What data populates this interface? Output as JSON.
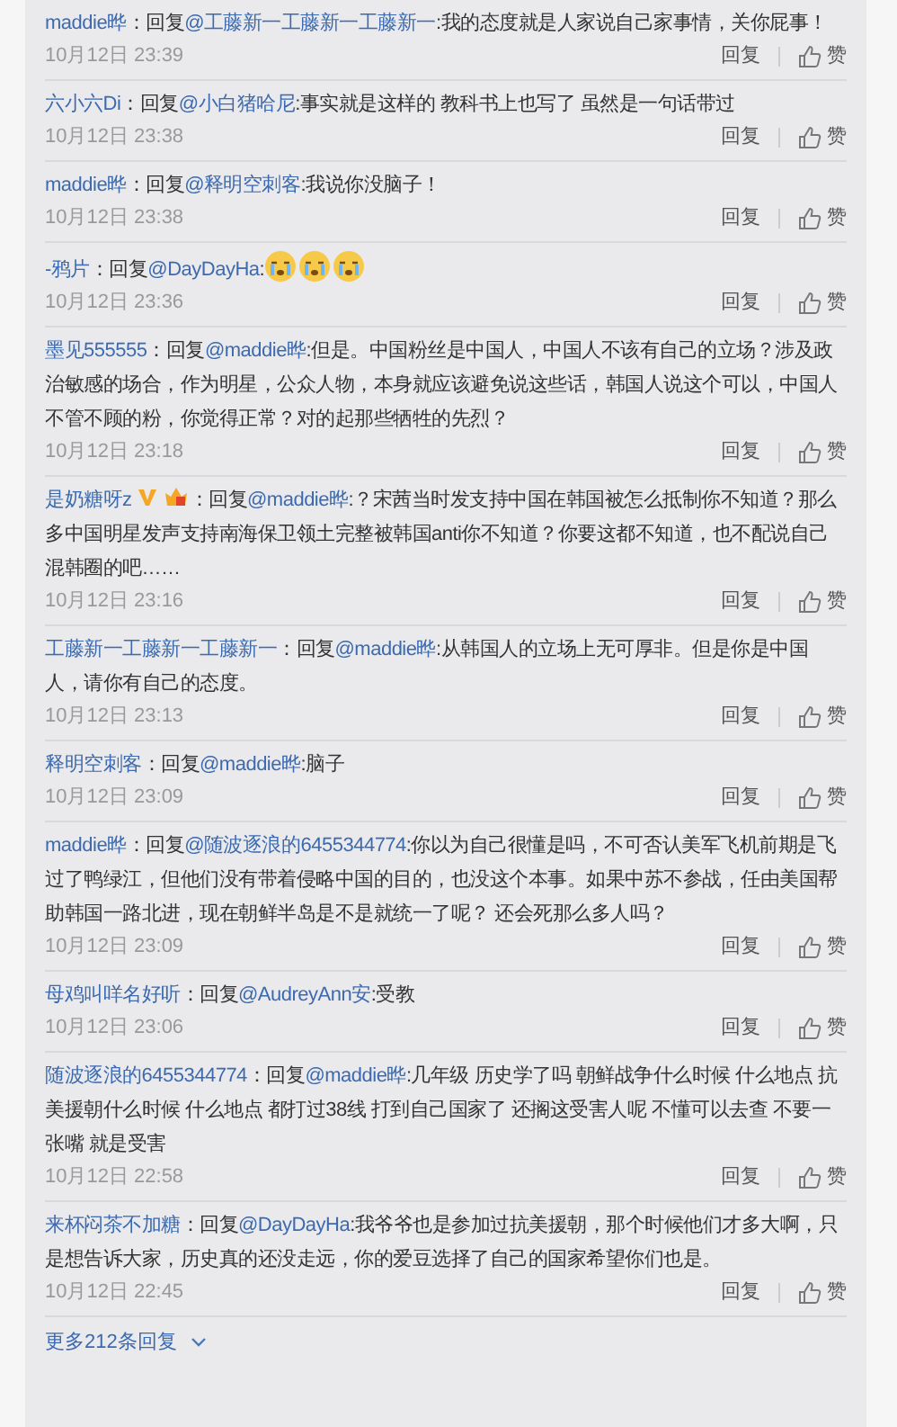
{
  "comments": [
    {
      "user": "maddie晔",
      "prefix": "：回复",
      "target": "@工藤新一工藤新一工藤新一",
      "body": ":我的态度就是人家说自己家事情，关你屁事！",
      "time": "10月12日 23:39",
      "reply": "回复",
      "like": "赞"
    },
    {
      "user": "六小六Di",
      "prefix": "：回复",
      "target": "@小白猪哈尼",
      "body": ":事实就是这样的 教科书上也写了 虽然是一句话带过",
      "time": "10月12日 23:38",
      "reply": "回复",
      "like": "赞"
    },
    {
      "user": "maddie晔",
      "prefix": "：回复",
      "target": "@释明空刺客",
      "body": ":我说你没脑子！",
      "time": "10月12日 23:38",
      "reply": "回复",
      "like": "赞"
    },
    {
      "user": "-鸦片",
      "prefix": "：回复",
      "target": "@DayDayHa",
      "body": ":",
      "emojis": [
        {
          "kind": "cry"
        },
        {
          "kind": "cry"
        },
        {
          "kind": "cry"
        }
      ],
      "time": "10月12日 23:36",
      "reply": "回复",
      "like": "赞"
    },
    {
      "user": "墨见555555",
      "prefix": "：回复",
      "target": "@maddie晔",
      "body": ":但是。中国粉丝是中国人，中国人不该有自己的立场？涉及政治敏感的场合，作为明星，公众人物，本身就应该避免说这些话，韩国人说这个可以，中国人不管不顾的粉，你觉得正常？对的起那些牺牲的先烈？",
      "time": "10月12日 23:18",
      "reply": "回复",
      "like": "赞"
    },
    {
      "user": "是奶糖呀z",
      "badges": [
        {
          "kind": "verified"
        },
        {
          "kind": "vip"
        }
      ],
      "prefix": "：回复",
      "target": "@maddie晔",
      "body": ":？宋茜当时发支持中国在韩国被怎么抵制你不知道？那么多中国明星发声支持南海保卫领土完整被韩国anti你不知道？你要这都不知道，也不配说自己混韩圈的吧……",
      "time": "10月12日 23:16",
      "reply": "回复",
      "like": "赞"
    },
    {
      "user": "工藤新一工藤新一工藤新一",
      "prefix": "：回复",
      "target": "@maddie晔",
      "body": ":从韩国人的立场上无可厚非。但是你是中国人，请你有自己的态度。",
      "time": "10月12日 23:13",
      "reply": "回复",
      "like": "赞"
    },
    {
      "user": "释明空刺客",
      "prefix": "：回复",
      "target": "@maddie晔",
      "body": ":脑子",
      "time": "10月12日 23:09",
      "reply": "回复",
      "like": "赞"
    },
    {
      "user": "maddie晔",
      "prefix": "：回复",
      "target": "@随波逐浪的6455344774",
      "body": ":你以为自己很懂是吗，不可否认美军飞机前期是飞过了鸭绿江，但他们没有带着侵略中国的目的，也没这个本事。如果中苏不参战，任由美国帮助韩国一路北进，现在朝鲜半岛是不是就统一了呢？ 还会死那么多人吗？",
      "time": "10月12日 23:09",
      "reply": "回复",
      "like": "赞"
    },
    {
      "user": "母鸡叫咩名好听",
      "prefix": "：回复",
      "target": "@AudreyAnn安",
      "body": ":受教",
      "time": "10月12日 23:06",
      "reply": "回复",
      "like": "赞"
    },
    {
      "user": "随波逐浪的6455344774",
      "prefix": "：回复",
      "target": "@maddie晔",
      "body": ":几年级 历史学了吗 朝鲜战争什么时候 什么地点 抗美援朝什么时候 什么地点 都打过38线 打到自己国家了 还搁这受害人呢 不懂可以去查 不要一张嘴 就是受害",
      "time": "10月12日 22:58",
      "reply": "回复",
      "like": "赞"
    },
    {
      "user": "来杯闷茶不加糖",
      "prefix": "：回复",
      "target": "@DayDayHa",
      "body": ":我爷爷也是参加过抗美援朝，那个时候他们才多大啊，只是想告诉大家，历史真的还没走远，你的爱豆选择了自己的国家希望你们也是。",
      "time": "10月12日 22:45",
      "reply": "回复",
      "like": "赞"
    }
  ],
  "more": "更多212条回复"
}
